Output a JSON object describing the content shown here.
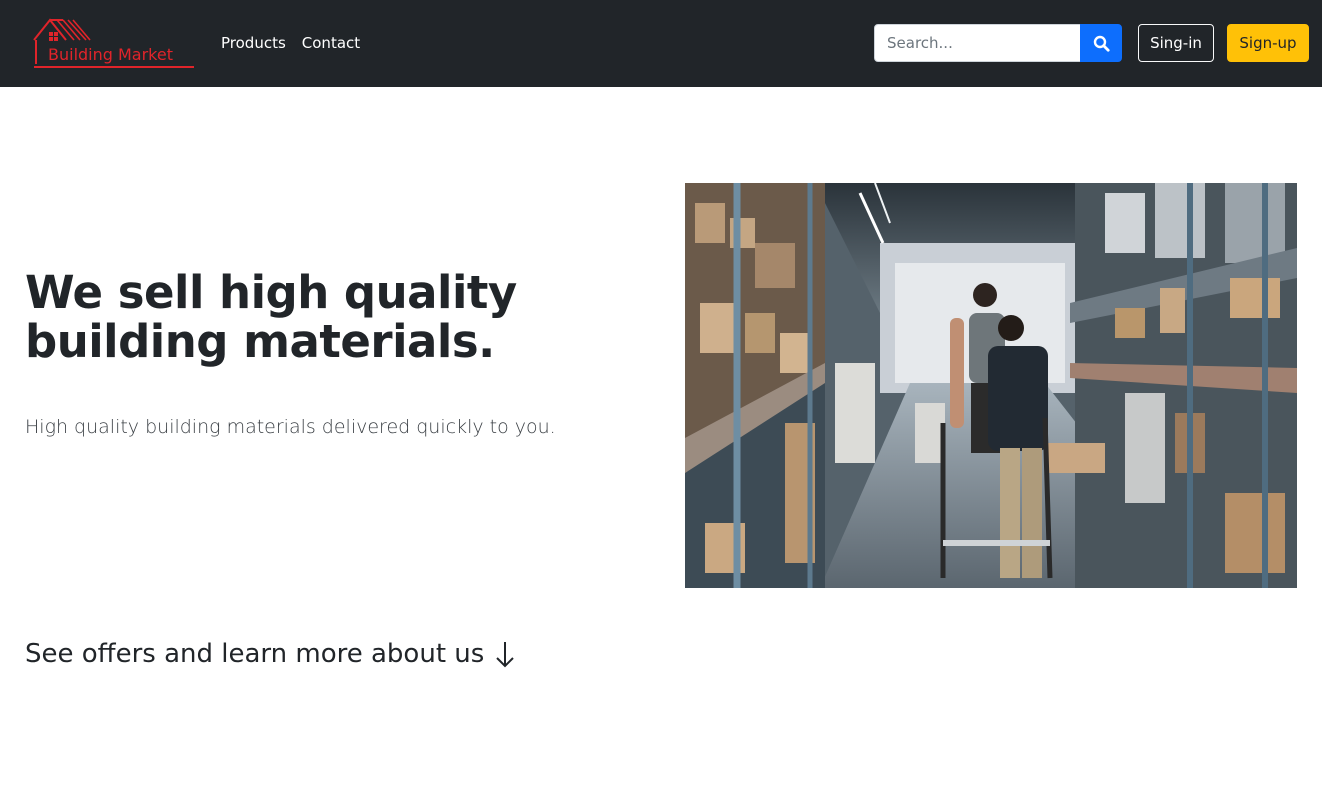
{
  "navbar": {
    "logo_text": "Building Market",
    "links": [
      "Products",
      "Contact"
    ],
    "search": {
      "placeholder": "Search...",
      "value": "",
      "icon": "search-icon"
    },
    "signin_label": "Sing-in",
    "signup_label": "Sign-up"
  },
  "hero": {
    "title": "We sell high quality building materials.",
    "lead": "High quality building materials delivered quickly to you.",
    "image_alt": "warehouse-photo"
  },
  "more": {
    "label": "See offers and learn more about us",
    "icon": "arrow-down-icon"
  },
  "colors": {
    "navbar_bg": "#212529",
    "logo_red": "#e0242a",
    "search_button": "#0d6efd",
    "signup_button": "#ffc107"
  }
}
